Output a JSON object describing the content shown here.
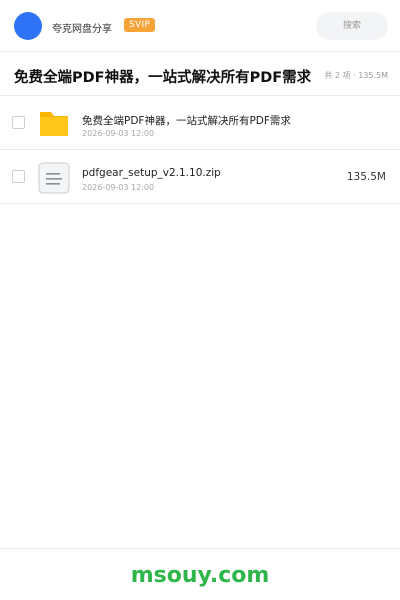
{
  "header": {
    "app_name": "夸克网盘分享",
    "badge": "SVIP",
    "search_label": "搜索"
  },
  "share": {
    "title": "免费全端PDF神器，一站式解决所有PDF需求",
    "summary": "共 2 项 · 135.5M"
  },
  "files": [
    {
      "name": "免费全端PDF神器，一站式解决所有PDF需求",
      "date": "2026-09-03 12:00",
      "size": "",
      "type": "folder-icon"
    },
    {
      "name": "pdfgear_setup_v2.1.10.zip",
      "date": "2026-09-03 12:00",
      "size": "135.5M",
      "type": "zip-file-icon"
    }
  ],
  "footer": {
    "watermark": "msouy.com"
  },
  "colors": {
    "avatar": "#2f74f6",
    "badge": "#f7a338",
    "folder": "#ffc61a",
    "watermark": "#2fb64a"
  }
}
